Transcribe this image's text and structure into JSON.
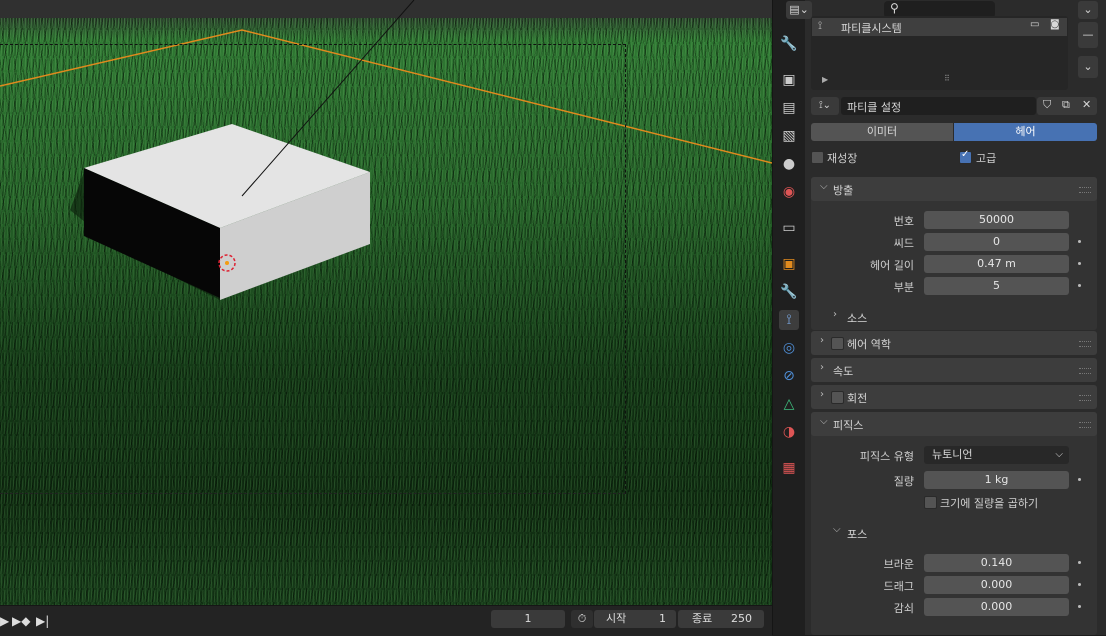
{
  "timeline": {
    "current_frame": "1",
    "start_label": "시작",
    "start_value": "1",
    "end_label": "종료",
    "end_value": "250"
  },
  "header": {
    "search_placeholder": ""
  },
  "particle_list": {
    "item_label": "파티클시스템"
  },
  "settings": {
    "name": "파티클 설정"
  },
  "tabs": {
    "emitter": "이미터",
    "hair": "헤어",
    "active": "hair"
  },
  "checkboxes": {
    "regrow_label": "재성장",
    "regrow_checked": false,
    "advanced_label": "고급",
    "advanced_checked": true
  },
  "emission": {
    "title": "방출",
    "number_label": "번호",
    "number_value": "50000",
    "seed_label": "씨드",
    "seed_value": "0",
    "hair_length_label": "헤어 길이",
    "hair_length_value": "0.47 m",
    "segments_label": "부분",
    "segments_value": "5",
    "source_label": "소스"
  },
  "sections": {
    "hair_dynamics": "헤어 역학",
    "velocity": "속도",
    "rotation": "회전",
    "physics": "피직스"
  },
  "physics": {
    "type_label": "피직스 유형",
    "type_value": "뉴토니언",
    "mass_label": "질량",
    "mass_value": "1 kg",
    "multiply_mass_label": "크기에 질량을 곱하기",
    "forces_title": "포스",
    "brownian_label": "브라운",
    "brownian_value": "0.140",
    "drag_label": "드래그",
    "drag_value": "0.000",
    "damp_label": "감쇠",
    "damp_value": "0.000"
  },
  "colors": {
    "accent": "#4772b3",
    "outline": "#e08a1e"
  },
  "tab_icons": [
    "tool-icon",
    "render-icon",
    "output-icon",
    "view-layer-icon",
    "scene-icon",
    "world-icon",
    "collection-icon",
    "object-icon",
    "modifier-icon",
    "particles-icon",
    "physics-icon",
    "constraints-icon",
    "data-icon",
    "material-icon",
    "texture-icon"
  ]
}
